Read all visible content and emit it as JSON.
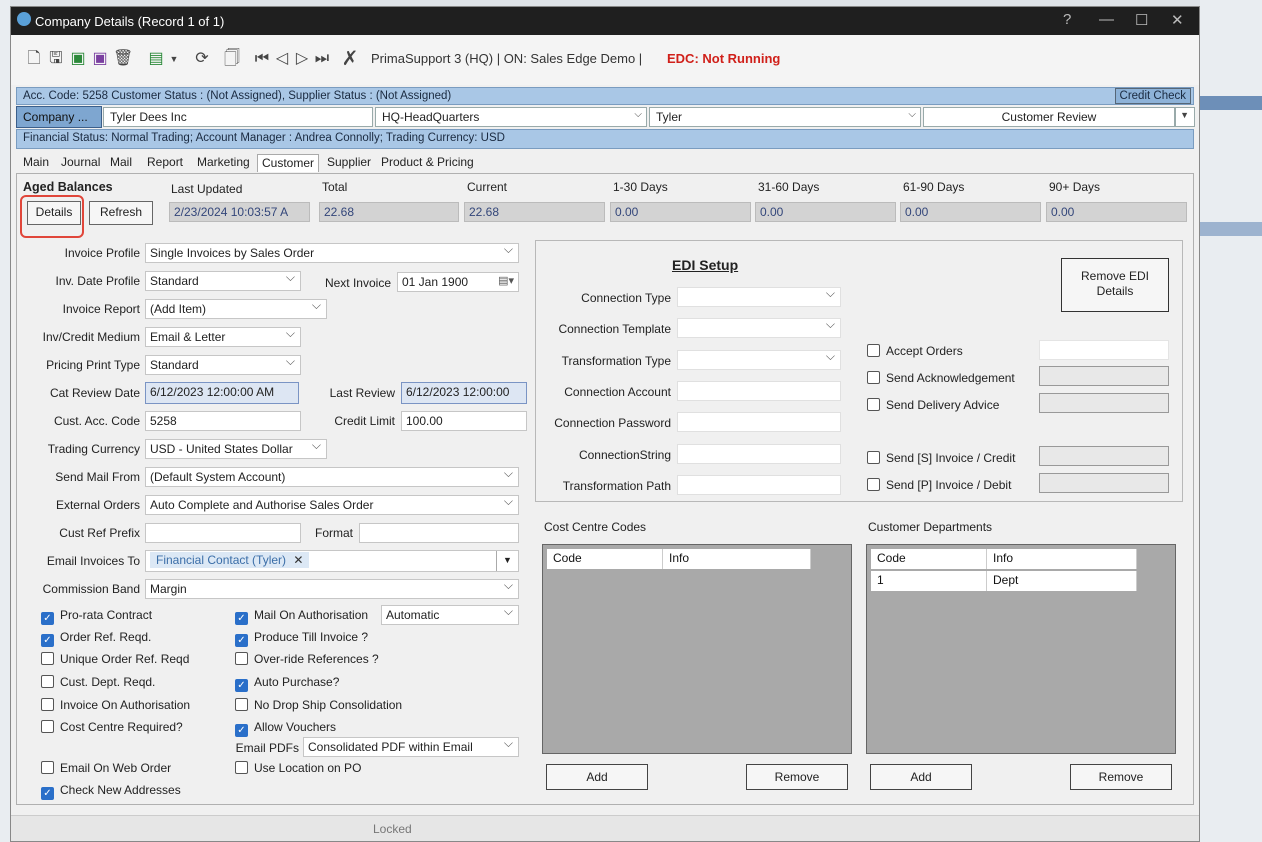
{
  "window": {
    "title": "Company Details  (Record 1 of 1)",
    "help": "?",
    "minimize": "—",
    "maximize": "☐",
    "close": "✕"
  },
  "toolbar": {
    "info": "PrimaSupport 3 (HQ) | ON: Sales Edge Demo |",
    "edc": "EDC: Not Running"
  },
  "header": {
    "info1": "Acc. Code: 5258  Customer Status : (Not Assigned), Supplier Status : (Not Assigned)",
    "credit_check": "Credit Check",
    "company_btn": "Company ...",
    "company_name": "Tyler Dees Inc",
    "branch": "HQ-HeadQuarters",
    "contact": "Tyler",
    "review": "Customer Review",
    "info2": "Financial Status: Normal Trading;  Account Manager : Andrea Connolly; Trading Currency: USD"
  },
  "tabs": [
    "Main",
    "Journal",
    "Mail",
    "Report",
    "Marketing",
    "Customer",
    "Supplier",
    "Product & Pricing"
  ],
  "aged": {
    "title": "Aged Balances",
    "details": "Details",
    "refresh": "Refresh",
    "headers": [
      "Last Updated",
      "Total",
      "Current",
      "1-30 Days",
      "31-60 Days",
      "61-90 Days",
      "90+ Days"
    ],
    "values": [
      "2/23/2024 10:03:57 A",
      "22.68",
      "22.68",
      "0.00",
      "0.00",
      "0.00",
      "0.00"
    ]
  },
  "form": {
    "invoice_profile": {
      "label": "Invoice Profile",
      "value": "Single Invoices by Sales Order"
    },
    "inv_date_profile": {
      "label": "Inv. Date Profile",
      "value": "Standard"
    },
    "next_invoice": {
      "label": "Next Invoice",
      "value": "01 Jan 1900"
    },
    "invoice_report": {
      "label": "Invoice Report",
      "value": "(Add Item)"
    },
    "credit_medium": {
      "label": "Inv/Credit Medium",
      "value": "Email & Letter"
    },
    "pricing_print": {
      "label": "Pricing Print Type",
      "value": "Standard"
    },
    "cat_review": {
      "label": "Cat Review Date",
      "value": "6/12/2023 12:00:00 AM"
    },
    "last_review": {
      "label": "Last Review",
      "value": "6/12/2023 12:00:00"
    },
    "cust_acc": {
      "label": "Cust. Acc. Code",
      "value": "5258"
    },
    "credit_limit": {
      "label": "Credit Limit",
      "value": "100.00"
    },
    "trading_currency": {
      "label": "Trading Currency",
      "value": "USD - United States Dollar"
    },
    "send_mail": {
      "label": "Send Mail From",
      "value": "(Default System Account)"
    },
    "external_orders": {
      "label": "External Orders",
      "value": "Auto Complete and Authorise Sales Order"
    },
    "cust_ref": {
      "label": "Cust Ref Prefix",
      "value": ""
    },
    "format": {
      "label": "Format",
      "value": ""
    },
    "email_invoices": {
      "label": "Email Invoices To",
      "value": "Financial Contact (Tyler)",
      "remove": "✕"
    },
    "commission": {
      "label": "Commission Band",
      "value": "Margin"
    },
    "mail_on_auth_value": "Automatic",
    "email_pdfs": {
      "label": "Email PDFs",
      "value": "Consolidated PDF within Email"
    }
  },
  "checks_left": [
    {
      "label": "Pro-rata Contract",
      "on": true
    },
    {
      "label": "Order Ref. Reqd.",
      "on": true
    },
    {
      "label": "Unique Order Ref. Reqd",
      "on": false
    },
    {
      "label": "Cust. Dept. Reqd.",
      "on": false
    },
    {
      "label": "Invoice On Authorisation",
      "on": false
    },
    {
      "label": "Cost Centre Required?",
      "on": false
    }
  ],
  "checks_mid": [
    {
      "label": "Mail On Authorisation",
      "on": true
    },
    {
      "label": "Produce Till Invoice ?",
      "on": true
    },
    {
      "label": "Over-ride References ?",
      "on": false
    },
    {
      "label": "Auto Purchase?",
      "on": true
    },
    {
      "label": "No Drop Ship Consolidation",
      "on": false
    },
    {
      "label": "Allow Vouchers",
      "on": true
    }
  ],
  "checks_bottom": [
    {
      "label": "Email On Web Order",
      "on": false
    },
    {
      "label": "Check New Addresses",
      "on": true
    },
    {
      "label": "Use Location on PO",
      "on": false
    }
  ],
  "edi": {
    "title": "EDI Setup",
    "remove": "Remove EDI Details",
    "fields": [
      "Connection Type",
      "Connection Template",
      "Transformation Type",
      "Connection Account",
      "Connection Password",
      "ConnectionString",
      "Transformation Path"
    ],
    "checks": [
      "Accept Orders",
      "Send Acknowledgement",
      "Send Delivery Advice",
      "Send [S] Invoice / Credit",
      "Send [P] Invoice / Debit"
    ]
  },
  "cost_centre": {
    "title": "Cost Centre Codes",
    "cols": [
      "Code",
      "Info"
    ],
    "add": "Add",
    "remove": "Remove"
  },
  "departments": {
    "title": "Customer Departments",
    "cols": [
      "Code",
      "Info"
    ],
    "rows": [
      [
        "1",
        "Dept"
      ]
    ],
    "add": "Add",
    "remove": "Remove"
  },
  "status": "Locked"
}
